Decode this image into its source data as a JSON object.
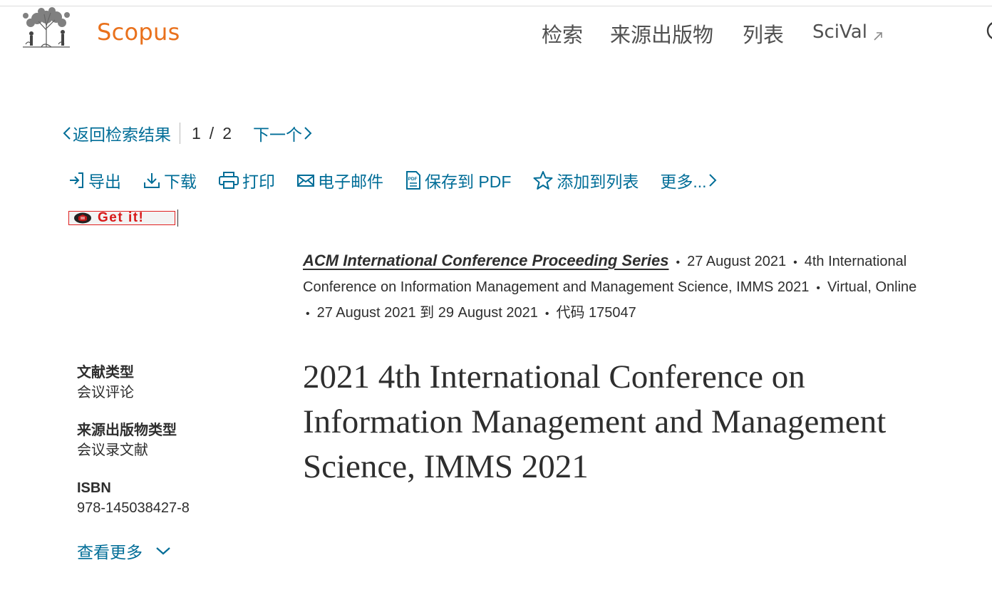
{
  "header": {
    "brand": "Scopus",
    "nav": {
      "search": "检索",
      "sources": "来源出版物",
      "lists": "列表",
      "scival": "SciVal"
    },
    "icons": [
      "elsevier-logo-icon",
      "external-link-icon",
      "search-icon"
    ]
  },
  "result_nav": {
    "back_label": "返回检索结果",
    "current": "1",
    "separator": "/",
    "total": "2",
    "next_label": "下一个"
  },
  "toolbar": {
    "export": "导出",
    "download": "下载",
    "print": "打印",
    "email": "电子邮件",
    "save_pdf": "保存到 PDF",
    "add_to_list": "添加到列表",
    "more": "更多..."
  },
  "getit": {
    "label": "Get it!"
  },
  "source": {
    "series": "ACM International Conference Proceeding Series",
    "date": "27 August 2021",
    "conference": "4th International Conference on Information Management and Management Science, IMMS 2021",
    "location": "Virtual, Online",
    "dates_range": "27 August 2021 到 29 August 2021",
    "code": "代码 175047"
  },
  "metadata": {
    "doc_type_label": "文献类型",
    "doc_type_value": "会议评论",
    "source_type_label": "来源出版物类型",
    "source_type_value": "会议录文献",
    "isbn_label": "ISBN",
    "isbn_value": "978-145038427-8",
    "show_more": "查看更多"
  },
  "document": {
    "title": "2021 4th International Conference on Information Management and Management Science, IMMS 2021"
  },
  "colors": {
    "brand_orange": "#e9711c",
    "link_blue": "#006d97",
    "text": "#2e2e2e",
    "getit_red": "#d81818"
  }
}
